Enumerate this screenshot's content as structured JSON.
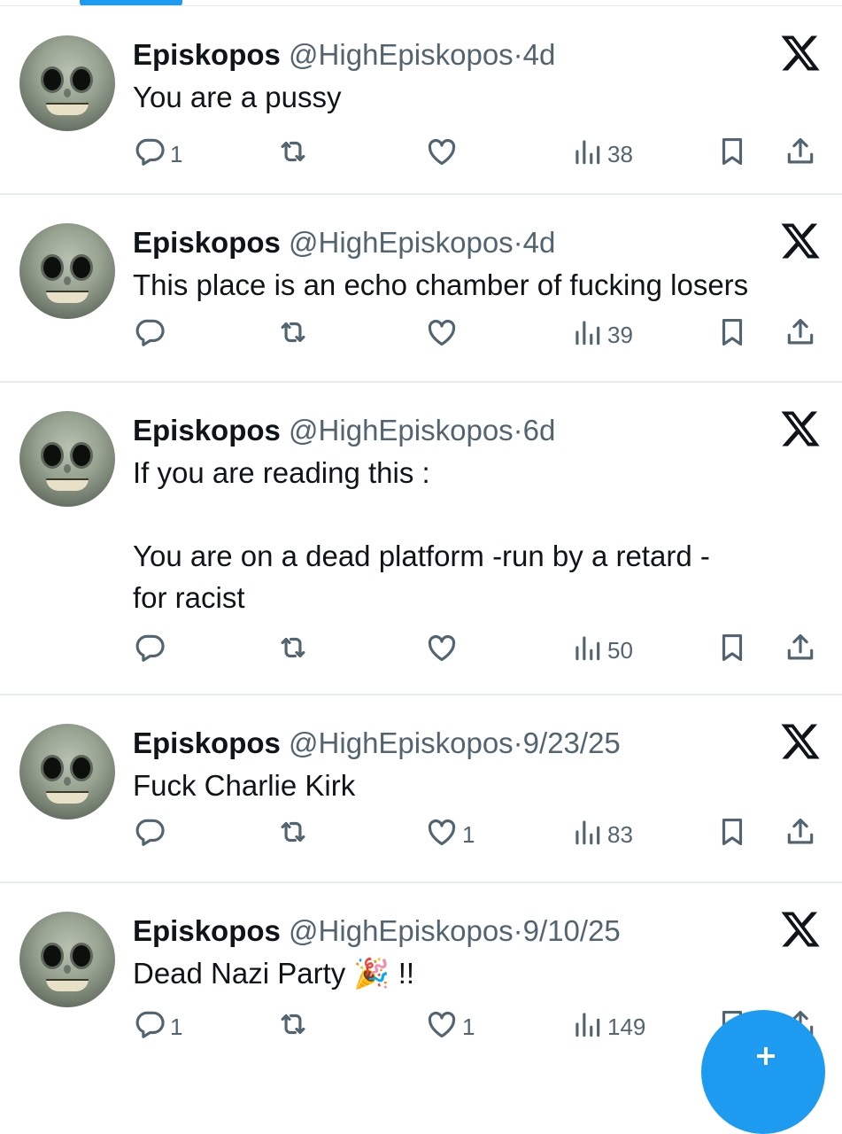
{
  "theme": {
    "accent": "#1d9bf0",
    "text": "#0f1419",
    "muted": "#536471",
    "divider": "#e6ecf0"
  },
  "tweets": [
    {
      "name": "Episkopos",
      "handle": "@HighEpiskopos",
      "dot": "·",
      "time": "4d",
      "text": "You are a pussy",
      "replies": "1",
      "retweets": "",
      "likes": "",
      "views": "38"
    },
    {
      "name": "Episkopos",
      "handle": "@HighEpiskopos",
      "dot": "·",
      "time": "4d",
      "text": "This place is an echo chamber of fucking losers",
      "replies": "",
      "retweets": "",
      "likes": "",
      "views": "39"
    },
    {
      "name": "Episkopos",
      "handle": "@HighEpiskopos",
      "dot": "·",
      "time": "6d",
      "text": "If you are reading this :\n\nYou are on a dead platform -run by a retard -\nfor racist",
      "replies": "",
      "retweets": "",
      "likes": "",
      "views": "50"
    },
    {
      "name": "Episkopos",
      "handle": "@HighEpiskopos",
      "dot": "·",
      "time": "9/23/25",
      "text": "Fuck Charlie Kirk",
      "replies": "",
      "retweets": "",
      "likes": "1",
      "views": "83"
    },
    {
      "name": "Episkopos",
      "handle": "@HighEpiskopos",
      "dot": "·",
      "time": "9/10/25",
      "text": "Dead Nazi Party 🎉 !!",
      "replies": "1",
      "retweets": "",
      "likes": "1",
      "views": "149"
    }
  ],
  "icons": {
    "reply": "reply-icon",
    "retweet": "retweet-icon",
    "like": "heart-icon",
    "views": "views-icon",
    "bookmark": "bookmark-icon",
    "share": "share-icon",
    "block": "x-icon",
    "compose": "compose-plus-icon"
  }
}
